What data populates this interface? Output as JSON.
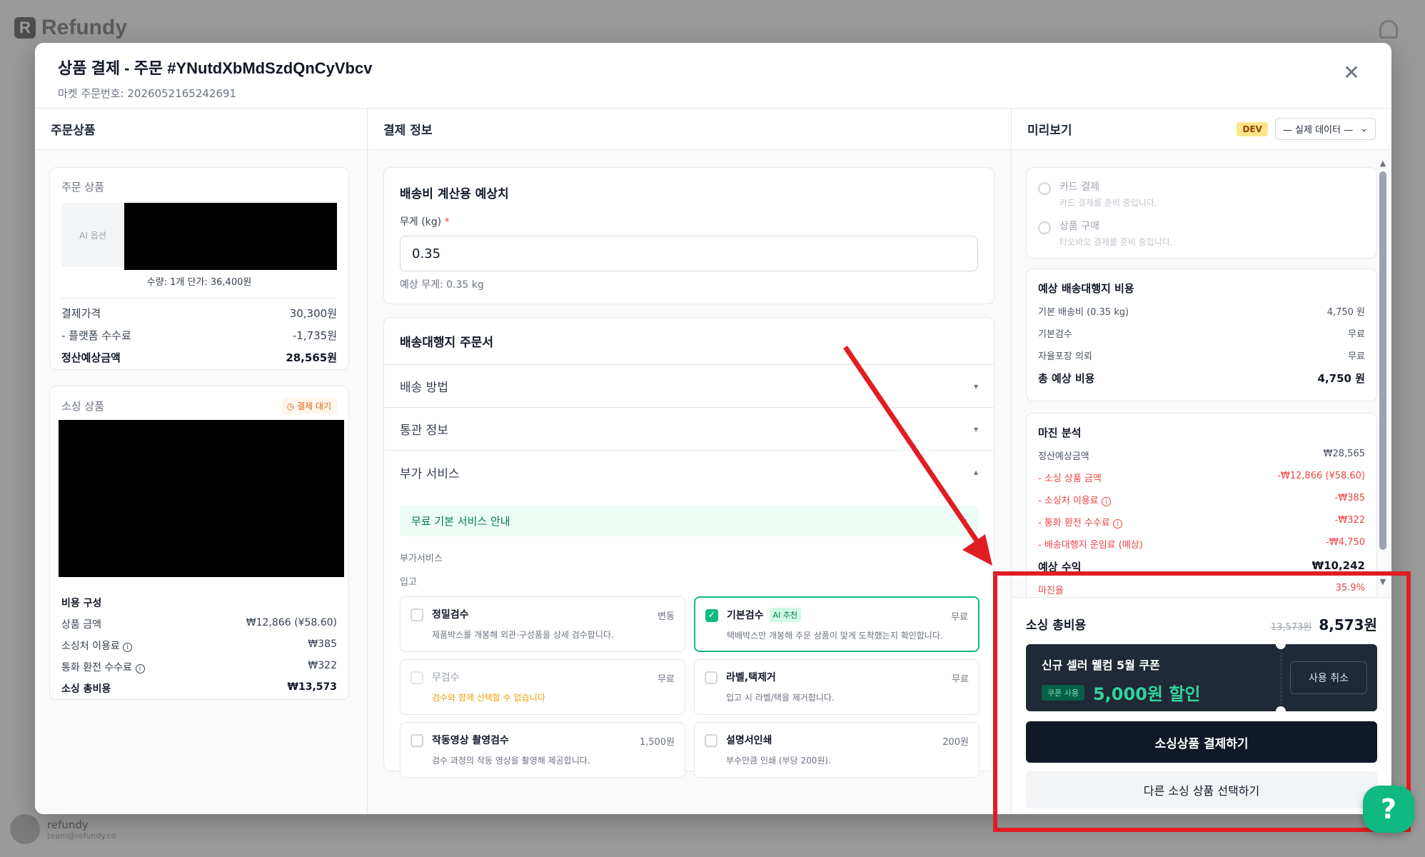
{
  "app": {
    "logo_text": "Refundy",
    "user_name": "refundy",
    "user_email": "team@refundy.co"
  },
  "modal": {
    "title": "상품 결제 - 주문 #YNutdXbMdSzdQnCyVbcv",
    "subtitle": "마켓 주문번호: 2026052165242691",
    "close_icon": "✕"
  },
  "col1": {
    "header": "주문상품",
    "order_card": {
      "label": "주문 상품",
      "ai_thumb": "AI 옵션",
      "qty_text": "수량: 1개 단가: 36,400원",
      "rows": [
        {
          "label": "결제가격",
          "value": "30,300원"
        },
        {
          "label": "- 플랫폼 수수료",
          "value": "-1,735원"
        }
      ],
      "settlement": {
        "label": "정산예상금액",
        "value": "28,565원"
      }
    },
    "sourcing_card": {
      "label": "소싱 상품",
      "status": "결제 대기",
      "cost_title": "비용 구성",
      "rows": [
        {
          "label": "상품 금액",
          "value": "₩12,866 (¥58.60)"
        },
        {
          "label": "소싱처 이용료",
          "value": "₩385"
        },
        {
          "label": "통화 환전 수수료",
          "value": "₩322"
        }
      ],
      "total": {
        "label": "소싱 총비용",
        "value": "₩13,573"
      }
    }
  },
  "col2": {
    "header": "결제 정보",
    "shipping_estimate": {
      "title": "배송비 계산용 예상치",
      "weight_label": "무게 (kg)",
      "required_mark": "*",
      "weight_value": "0.35",
      "hint": "예상 무게: 0.35 kg"
    },
    "agent_order": {
      "title": "배송대행지 주문서",
      "sections": [
        {
          "label": "배송 방법",
          "chevron": "▾"
        },
        {
          "label": "통관 정보",
          "chevron": "▾"
        },
        {
          "label": "부가 서비스",
          "chevron": "▴"
        }
      ],
      "notice": "무료 기본 서비스 안내",
      "notice_chevron": "▾",
      "sub_label": "부가서비스",
      "group_label": "입고",
      "services": [
        {
          "name": "정밀검수",
          "price": "변동",
          "desc": "제품박스를 개봉해 외관·구성품을 상세 검수합니다.",
          "state": "off",
          "tag": ""
        },
        {
          "name": "기본검수",
          "price": "무료",
          "desc": "택배박스만 개봉해 주문 상품이 맞게 도착했는지 확인합니다.",
          "state": "on",
          "tag": "AI 추천"
        },
        {
          "name": "무검수",
          "price": "무료",
          "desc": "검수와 함께 선택할 수 없습니다",
          "state": "dis",
          "tag": ""
        },
        {
          "name": "라벨,택제거",
          "price": "무료",
          "desc": "입고 시 라벨/택을 제거합니다.",
          "state": "off",
          "tag": ""
        },
        {
          "name": "작동영상 촬영검수",
          "price": "1,500원",
          "desc": "검수 과정의 작동 영상을 촬영해 제공합니다.",
          "state": "off",
          "tag": ""
        },
        {
          "name": "설명서인쇄",
          "price": "200원",
          "desc": "부수만큼 인쇄 (부당 200원).",
          "state": "off",
          "tag": ""
        }
      ]
    }
  },
  "col3": {
    "header": "미리보기",
    "dev_badge": "DEV",
    "data_select": "— 실제 데이터 —",
    "payment_options": [
      {
        "title": "카드 결제",
        "desc": "카드 결제를 준비 중입니다."
      },
      {
        "title": "상품 구매",
        "desc": "타오바오 결제를 준비 중입니다."
      }
    ],
    "shipping_cost": {
      "title": "예상 배송대행지 비용",
      "rows": [
        {
          "label": "기본 배송비 (0.35 kg)",
          "value": "4,750 원"
        },
        {
          "label": "기본검수",
          "value": "무료"
        },
        {
          "label": "자율포장 의뢰",
          "value": "무료"
        }
      ],
      "total": {
        "label": "총 예상 비용",
        "value": "4,750 원"
      }
    },
    "margin": {
      "title": "마진 분석",
      "settle": {
        "label": "정산예상금액",
        "value": "₩28,565"
      },
      "deductions": [
        {
          "label": "- 소싱 상품 금액",
          "value": "-₩12,866 (¥58.60)"
        },
        {
          "label": "- 소싱처 이용료",
          "value": "-₩385"
        },
        {
          "label": "- 통화 환전 수수료",
          "value": "-₩322"
        },
        {
          "label": "- 배송대행지 운임료 (예상)",
          "value": "-₩4,750"
        }
      ],
      "profit": {
        "label": "예상 수익",
        "value": "₩10,242"
      },
      "rate": {
        "label": "마진율",
        "value": "35.9%"
      }
    },
    "footer": {
      "total_label": "소싱 총비용",
      "original": "13,573원",
      "amount": "8,573원",
      "coupon_name": "신규 셀러 웰컴 5월 쿠폰",
      "coupon_used": "쿠폰 사용",
      "discount": "5,000원 할인",
      "cancel": "사용 취소",
      "pay_button": "소싱상품 결제하기",
      "other_button": "다른 소싱 상품 선택하기"
    }
  },
  "help_icon": "?",
  "colors": {
    "accent_green": "#10b981",
    "annotation_red": "#e11d24",
    "dark": "#111827"
  }
}
